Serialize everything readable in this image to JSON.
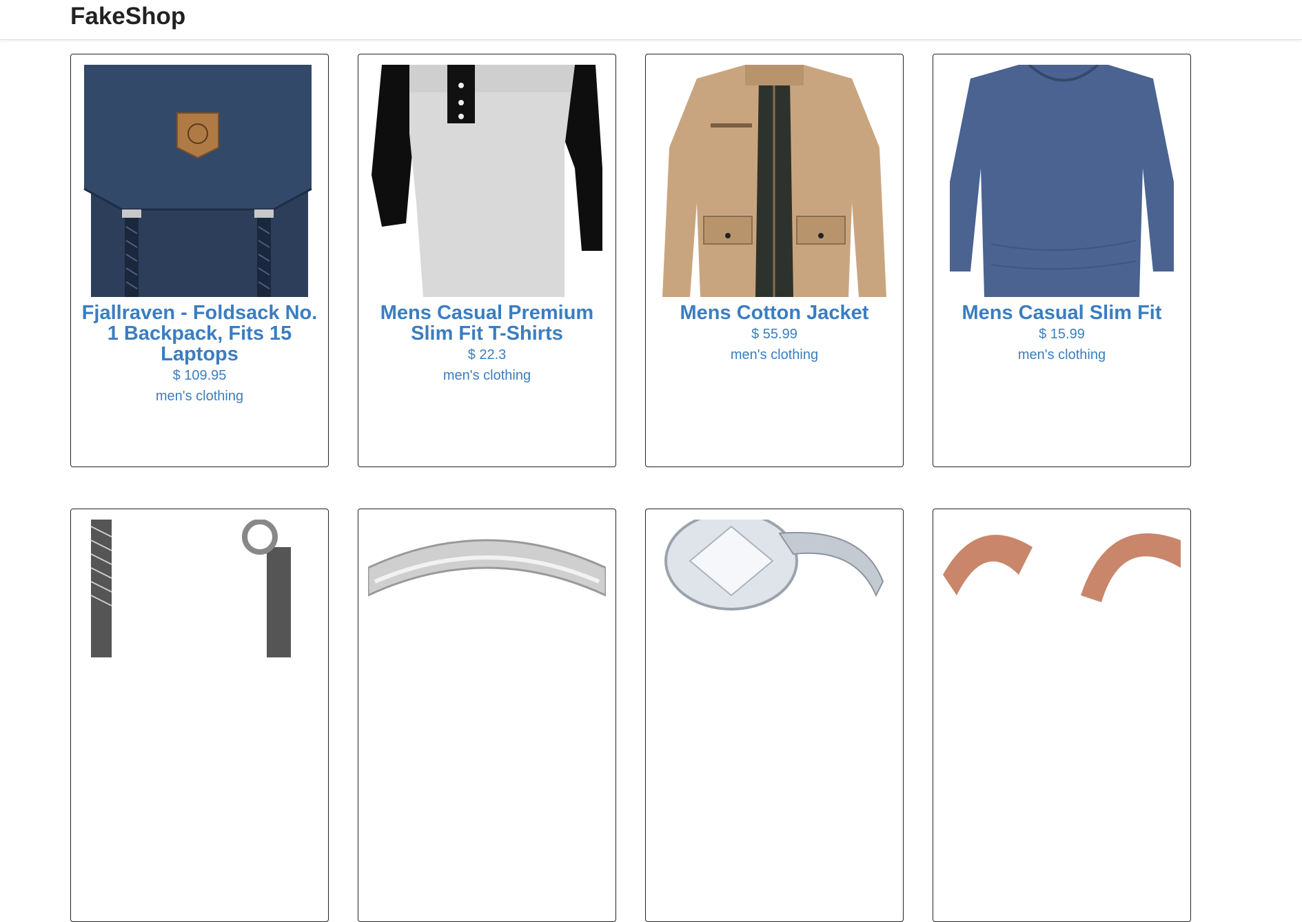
{
  "navbar": {
    "brand": "FakeShop"
  },
  "products": [
    {
      "title": "Fjallraven - Foldsack No. 1 Backpack, Fits 15 Laptops",
      "price": "$ 109.95",
      "category": "men's clothing",
      "image_icon": "backpack-image"
    },
    {
      "title": "Mens Casual Premium Slim Fit T-Shirts",
      "price": "$ 22.3",
      "category": "men's clothing",
      "image_icon": "tshirt-image"
    },
    {
      "title": "Mens Cotton Jacket",
      "price": "$ 55.99",
      "category": "men's clothing",
      "image_icon": "jacket-image"
    },
    {
      "title": "Mens Casual Slim Fit",
      "price": "$ 15.99",
      "category": "men's clothing",
      "image_icon": "longsleeve-image"
    },
    {
      "image_icon": "bracelet-image"
    },
    {
      "image_icon": "ring-image"
    },
    {
      "image_icon": "diamond-ring-image"
    },
    {
      "image_icon": "rose-gold-earrings-image"
    }
  ],
  "colors": {
    "link": "#3b7dc0",
    "border": "#222222"
  }
}
